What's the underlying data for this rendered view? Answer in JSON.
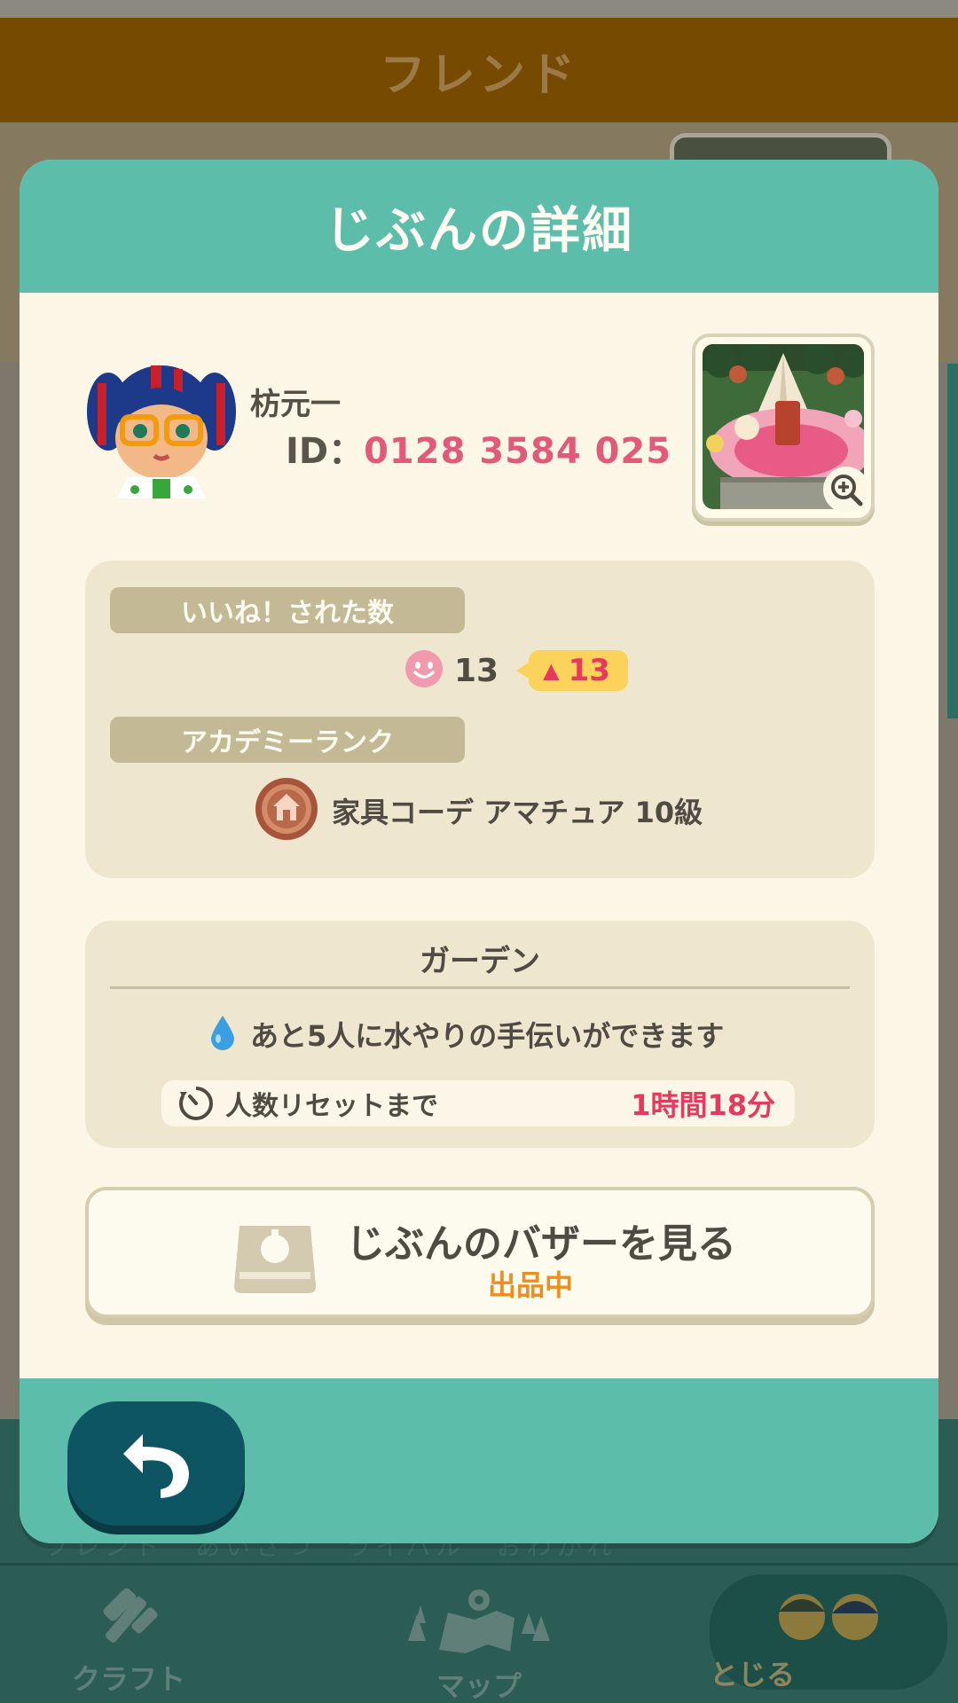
{
  "background": {
    "header_title": "フレンド",
    "bottom_nav": {
      "faint_text": "フレンド　あいさつ　ライバル　おわかれ",
      "items": [
        {
          "label": "クラフト",
          "icon": "hammer-icon"
        },
        {
          "label": "マップ",
          "icon": "map-icon"
        },
        {
          "label": "とじる",
          "icon": "villagers-icon"
        }
      ]
    }
  },
  "modal": {
    "title": "じぶんの詳細",
    "profile": {
      "name": "枋元一",
      "id_label": "ID：",
      "id_value": "0128 3584 025"
    },
    "stats": {
      "likes_label": "いいね！された数",
      "likes_count": "13",
      "likes_delta": "13",
      "rank_label": "アカデミーランク",
      "rank_value": "家具コーデ アマチュア 10級"
    },
    "garden": {
      "title": "ガーデン",
      "water_text": "あと5人に水やりの手伝いができます",
      "reset_label": "人数リセットまで",
      "reset_value": "1時間18分"
    },
    "bazaar": {
      "label": "じぶんのバザーを見る",
      "status": "出品中"
    }
  },
  "colors": {
    "teal": "#5cbdaa",
    "cream": "#fbf6e6",
    "accent_pink": "#e25a7a",
    "accent_orange": "#f08c1d",
    "header_brown": "#774a02",
    "back_button": "#0d5562"
  }
}
